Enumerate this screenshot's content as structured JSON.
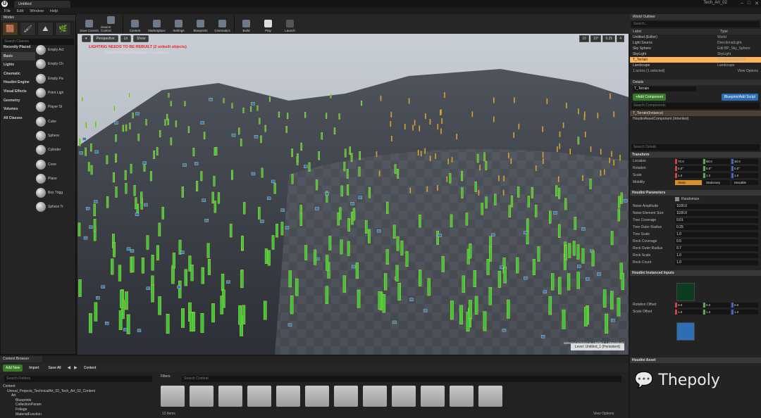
{
  "app": {
    "doc_tab": "Untitled",
    "project": "Tech_Art_02",
    "menu": [
      "File",
      "Edit",
      "Window",
      "Help"
    ]
  },
  "modes": {
    "title": "Modes",
    "search_placeholder": "Search Classes",
    "categories": [
      "Recently Placed",
      "Basic",
      "Lights",
      "Cinematic",
      "Houdini Engine",
      "Visual Effects",
      "Geometry",
      "Volumes",
      "All Classes"
    ],
    "items": [
      "Empty Act",
      "Empty Ch",
      "Empty Pa",
      "Point Ligh",
      "Player St",
      "Cube",
      "Sphere",
      "Cylinder",
      "Cone",
      "Plane",
      "Box Trigg",
      "Sphere Tr"
    ]
  },
  "toolbar": [
    "Save Current",
    "Source Control",
    "Content",
    "Marketplace",
    "Settings",
    "Blueprints",
    "Cinematics",
    "Build",
    "Play",
    "Launch"
  ],
  "viewport": {
    "perspective": "Perspective",
    "lit": "Lit",
    "show": "Show",
    "snap_values": [
      "10",
      "10°",
      "0.25",
      "4"
    ],
    "warning": "LIGHTING NEEDS TO BE REBUILT (2 unbuilt objects)",
    "sub": "DisableAllScreenMessages' to suppress",
    "level_info": "Selected Actor(s) in: Untitled_1 (Persistent)",
    "level": "Level: Untitled_1 (Persistent)"
  },
  "outliner": {
    "title": "World Outliner",
    "search_placeholder": "Search...",
    "col_label": "Label",
    "col_type": "Type",
    "rows": [
      {
        "label": "Untitled (Editor)",
        "type": "World",
        "sel": false
      },
      {
        "label": "Light Source",
        "type": "DirectionalLight",
        "sel": false
      },
      {
        "label": "Sky Sphere",
        "type": "Edit BP_Sky_Sphere",
        "sel": false
      },
      {
        "label": "SkyLight",
        "type": "SkyLight",
        "sel": false
      },
      {
        "label": "T_Terrain",
        "type": "HoudiniAssetActor",
        "sel": true
      },
      {
        "label": "Landscape",
        "type": "Landscape",
        "sel": false
      }
    ],
    "status": "1 actors (1 selected)",
    "view_options": "View Options"
  },
  "details": {
    "title": "Details",
    "actor_name": "T_Terrain",
    "add_component": "+Add Component",
    "blueprint_script": "Blueprint/Add Script",
    "component_search": "Search Components",
    "components": [
      "T_Terrain(Instance)",
      "HoudiniAssetComponent (Inherited)"
    ],
    "search_details": "Search Details",
    "transform_label": "Transform",
    "location_label": "Location",
    "rotation_label": "Rotation",
    "scale_label": "Scale",
    "mobility_label": "Mobility",
    "location": [
      "70.0",
      "90.0",
      "30.0"
    ],
    "rotation": [
      "0.0°",
      "0.0°",
      "0.0°"
    ],
    "scale": [
      "1.0",
      "1.0",
      "1.0"
    ],
    "mobility": [
      "Static",
      "Stationary",
      "Movable"
    ],
    "houdini_params": "Houdini Parameters",
    "randomize": "Randomize",
    "params": [
      {
        "label": "Noise Amplitude",
        "value": "1100.0"
      },
      {
        "label": "Noise Element Size",
        "value": "1100.0"
      },
      {
        "label": "Tree Coverage",
        "value": "0.01"
      },
      {
        "label": "Tree Outer Radius",
        "value": "0.25"
      },
      {
        "label": "Tree Scale",
        "value": "1.0"
      },
      {
        "label": "Rock Coverage",
        "value": "0.5"
      },
      {
        "label": "Rock Outer Radius",
        "value": "0.7"
      },
      {
        "label": "Rock Scale",
        "value": "1.0"
      },
      {
        "label": "Rock Count",
        "value": "1.0"
      }
    ],
    "instanced_inputs": "Houdini Instanced Inputs",
    "rotation_offset": "Rotation Offset",
    "scale_offset": "Scale Offset",
    "houdini_asset": "Houdini Asset"
  },
  "content_browser": {
    "tab": "Content Browser",
    "add_new": "Add New",
    "import": "Import",
    "save_all": "Save All",
    "content": "Content",
    "search_folders": "Search Folders",
    "filters": "Filters",
    "search_content": "Search Content",
    "tree": [
      "Content",
      "Unreal_Projects_TechnicalArt_02_Tech_Art_02_Content",
      "Art",
      "Blueprints",
      "CollectionParam",
      "Foliage",
      "MaterialFunction"
    ],
    "item_count": "13 items",
    "view_options": "View Options"
  },
  "watermark": "Thepoly"
}
